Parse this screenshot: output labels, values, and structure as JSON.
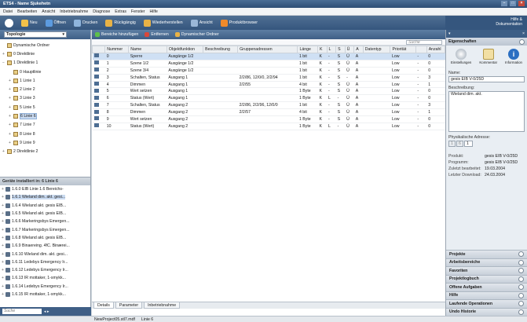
{
  "app": {
    "title": "ETS4 - Name Sjukehetn",
    "watermark": "RSFG·N"
  },
  "menu": [
    "Datei",
    "Bearbeiten",
    "Ansicht",
    "Inbetriebnahme",
    "Diagnose",
    "Extras",
    "Fenster",
    "Hilfe"
  ],
  "toolbar": {
    "items": [
      "Neu",
      "Öffnen",
      "Drucken",
      "Rückgängig",
      "Wiederherstellen",
      "Ansicht",
      "Produktbrowser"
    ],
    "help": [
      "Hilfe &",
      "Dokumentation"
    ]
  },
  "left": {
    "panel_title": "Topologie",
    "tree": [
      {
        "label": "Dynamische Ordner",
        "exp": "",
        "indent": 0
      },
      {
        "label": "0 Direktlinie",
        "exp": "+",
        "indent": 0
      },
      {
        "label": "1 Direktlinie 1",
        "exp": "−",
        "indent": 0
      },
      {
        "label": "0 Hauptlinie",
        "exp": "",
        "indent": 1
      },
      {
        "label": "1 Linie 1",
        "exp": "+",
        "indent": 1
      },
      {
        "label": "2 Linie 2",
        "exp": "+",
        "indent": 1
      },
      {
        "label": "3 Linie 3",
        "exp": "+",
        "indent": 1
      },
      {
        "label": "5 Linie 5",
        "exp": "+",
        "indent": 1
      },
      {
        "label": "6 Linie 6",
        "exp": "+",
        "indent": 1,
        "sel": true
      },
      {
        "label": "7 Linie 7",
        "exp": "+",
        "indent": 1
      },
      {
        "label": "8 Linie 8",
        "exp": "+",
        "indent": 1
      },
      {
        "label": "9 Linie 9",
        "exp": "+",
        "indent": 1
      },
      {
        "label": "2 Direktlinie 2",
        "exp": "+",
        "indent": 0
      }
    ],
    "devices_title": "Geräte installiert in: 6 Linie 6",
    "devices": [
      "1.6.0 EIB Linie 1.6 Bereichs-",
      "1.6.1 Wieland dim. akt. gesi...",
      "1.6.4 Wieland akt. gesis EIB...",
      "1.6.5 Wieland akt. gesis EIB...",
      "1.6.6 Markeringsbys Emergen...",
      "1.6.7 Markeringsbys Emergen...",
      "1.6.8 Wieland akt. gesis EIB...",
      "1.6.9 Binaereing. 4fC. Binærei...",
      "1.6.10 Wieland dim. akt. gesi...",
      "1.6.11 Ledebys Emergency Ir...",
      "1.6.12 Ledebys Emergency Ir...",
      "1.6.13 IR mottaker, 1-smykk...",
      "1.6.14 Ledebys Emergency Ir...",
      "1.6.15 IR mottaker, 1-smykk..."
    ],
    "search_placeholder": "Suche"
  },
  "center": {
    "panel_title": "Topologie",
    "actions": [
      "Bereiche hinzufügen",
      "Entfernen",
      "Dynamischer Ordner"
    ],
    "search_placeholder": "Suche",
    "columns": [
      "",
      "Nummer",
      "Name",
      "Objektfunktion",
      "Beschreibung",
      "Gruppenadressen",
      "Länge",
      "K",
      "L",
      "S",
      "Ü",
      "A",
      "Datentyp",
      "Priorität",
      "",
      "Anzahl"
    ],
    "rows": [
      [
        "0",
        "Sperre",
        "Ausgänge 1/2",
        "",
        "",
        "1 bit",
        "K",
        "-",
        "S",
        "Ü",
        "A",
        "",
        "Low",
        "-",
        "0"
      ],
      [
        "1",
        "Szene 1/2",
        "Ausgänge 1/2",
        "",
        "",
        "1 bit",
        "K",
        "-",
        "S",
        "Ü",
        "A",
        "",
        "Low",
        "-",
        "0"
      ],
      [
        "2",
        "Szene 3/4",
        "Ausgänge 1/2",
        "",
        "",
        "1 bit",
        "K",
        "-",
        "S",
        "Ü",
        "A",
        "",
        "Low",
        "-",
        "0"
      ],
      [
        "3",
        "Schalten, Status",
        "Ausgang 1",
        "",
        "2/2/86, 12/0/0, 2/2/94",
        "1 bit",
        "K",
        "-",
        "S",
        "-",
        "A",
        "",
        "Low",
        "-",
        "3"
      ],
      [
        "4",
        "Dimmen",
        "Ausgang 1",
        "",
        "2/2/55",
        "4 bit",
        "K",
        "-",
        "S",
        "Ü",
        "A",
        "",
        "Low",
        "-",
        "1"
      ],
      [
        "5",
        "Wert setzen",
        "Ausgang 1",
        "",
        "",
        "1 Byte",
        "K",
        "-",
        "S",
        "Ü",
        "A",
        "",
        "Low",
        "-",
        "0"
      ],
      [
        "6",
        "Status (Wert)",
        "Ausgang 1",
        "",
        "",
        "1 Byte",
        "K",
        "L",
        "-",
        "Ü",
        "A",
        "",
        "Low",
        "-",
        "0"
      ],
      [
        "7",
        "Schalten, Status",
        "Ausgang 2",
        "",
        "2/2/86, 2/2/96, 12/0/0",
        "1 bit",
        "K",
        "-",
        "S",
        "Ü",
        "A",
        "",
        "Low",
        "-",
        "3"
      ],
      [
        "8",
        "Dimmen",
        "Ausgang 2",
        "",
        "2/2/57",
        "4 bit",
        "K",
        "-",
        "S",
        "Ü",
        "A",
        "",
        "Low",
        "-",
        "1"
      ],
      [
        "9",
        "Wert setzen",
        "Ausgang 2",
        "",
        "",
        "1 Byte",
        "K",
        "-",
        "S",
        "Ü",
        "A",
        "",
        "Low",
        "-",
        "0"
      ],
      [
        "10",
        "Status (Wert)",
        "Ausgang 2",
        "",
        "",
        "1 Byte",
        "K",
        "L",
        "-",
        "Ü",
        "A",
        "",
        "Low",
        "-",
        "0"
      ]
    ],
    "tabs": [
      "Details",
      "Parameter",
      "Inbetriebnahme"
    ],
    "status": [
      "NewProject05.stl7.mdf",
      "Linie 6"
    ]
  },
  "right": {
    "section": "Eigenschaften",
    "icons": [
      "Einstellungen",
      "Kommentar",
      "Information"
    ],
    "name_label": "Name:",
    "name_value": "gesis EIB V-0/25D",
    "desc_label": "Beschreibung:",
    "desc_value": "Wieland dim. akt.",
    "addr_label": "Physikalische Adresse:",
    "addr": [
      "1",
      "6",
      "1"
    ],
    "props": [
      {
        "k": "Produkt:",
        "v": "gesis EIB V-0/25D"
      },
      {
        "k": "Programm:",
        "v": "gesis EIB V-0/25D"
      },
      {
        "k": "Zuletzt bearbeitet:",
        "v": "19.03.2004"
      },
      {
        "k": "Letzter Download:",
        "v": "24.03.2004"
      }
    ],
    "accordion": [
      "Projekte",
      "Arbeitsbereiche",
      "Favoriten",
      "Projektlogbuch",
      "Offene Aufgaben",
      "Hilfe",
      "Laufende Operationen",
      "Undo Historie"
    ]
  }
}
